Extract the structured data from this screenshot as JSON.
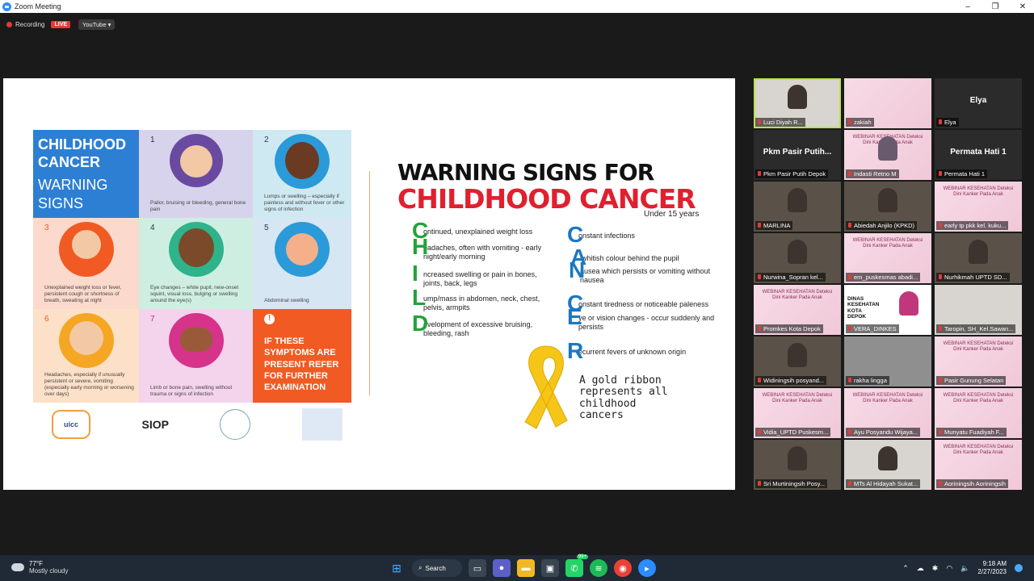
{
  "window": {
    "title": "Zoom Meeting",
    "controls": [
      "–",
      "❐",
      "✕"
    ]
  },
  "meeting": {
    "recording_label": "Recording",
    "live_badge": "LIVE",
    "stream_menu": "YouTube ▾"
  },
  "slide": {
    "poster": {
      "title_bold": "CHILDHOOD CANCER",
      "title_light": "WARNING SIGNS",
      "cells": [
        {
          "num": "1",
          "text": "Pallor, bruising or bleeding, general bone pain"
        },
        {
          "num": "2",
          "text": "Lumps or swelling – especially if painless and without fever or other signs of infection"
        },
        {
          "num": "3",
          "text": "Unexplained weight loss or fever, persistent cough or shortness of breath, sweating at night"
        },
        {
          "num": "4",
          "text": "Eye changes – white pupil, new-onset squint, visual loss, bulging or swelling around the eye(s)"
        },
        {
          "num": "5",
          "text": "Abdominal swelling"
        },
        {
          "num": "6",
          "text": "Headaches, especially if unusually persistent or severe, vomiting (especially early morning or worsening over days)"
        },
        {
          "num": "7",
          "text": "Limb or bone pain, swelling without trauma or signs of infection"
        }
      ],
      "cta_text": "IF THESE SYMPTOMS ARE PRESENT REFER FOR FURTHER EXAMINATION",
      "logos": [
        "uicc",
        "SIOP"
      ]
    },
    "ws_title_1": "WARNING SIGNS FOR",
    "ws_title_2": "CHILDHOOD CANCER",
    "ws_subtitle": "Under 15 years",
    "child": [
      {
        "letter": "C",
        "text": "ontinued, unexplained weight loss"
      },
      {
        "letter": "H",
        "text": "eadaches, often with vomiting - early night/early morning"
      },
      {
        "letter": "I",
        "text": "ncreased swelling or pain in bones, joints, back, legs"
      },
      {
        "letter": "L",
        "text": "ump/mass in abdomen, neck, chest, pelvis, armpits"
      },
      {
        "letter": "D",
        "text": "evelopment of excessive bruising, bleeding, rash"
      }
    ],
    "cancer": [
      {
        "letter": "C",
        "text": "onstant infections"
      },
      {
        "letter": "A",
        "text": "whitish colour behind the pupil"
      },
      {
        "letter": "N",
        "text": "ausea which persists or vomiting without nausea"
      },
      {
        "letter": "C",
        "text": "onstant tiredness or noticeable paleness"
      },
      {
        "letter": "E",
        "text": "ye or vision changes - occur suddenly and persists"
      },
      {
        "letter": "R",
        "text": "ecurrent fevers of unknown origin"
      }
    ],
    "ribbon_text": "A gold ribbon represents all childhood cancers"
  },
  "participants": [
    {
      "name": "Luci Diyah R...",
      "kind": "photo-light",
      "active": true
    },
    {
      "name": "zakiah",
      "kind": "slide"
    },
    {
      "name": "Elya",
      "kind": "name",
      "big": "Elya"
    },
    {
      "name": "Pkm Pasir Putih Depok",
      "kind": "name",
      "big": "Pkm Pasir Putih..."
    },
    {
      "name": "Indasti Retno M",
      "kind": "pink-person"
    },
    {
      "name": "Permata Hati 1",
      "kind": "name",
      "big": "Permata Hati 1"
    },
    {
      "name": "MARLINA",
      "kind": "photo"
    },
    {
      "name": "Abiedah Anjilo (KPKD)",
      "kind": "photo"
    },
    {
      "name": "early tp pkk kel. kuku...",
      "kind": "pink"
    },
    {
      "name": "Nurwina_Sopran kel...",
      "kind": "photo"
    },
    {
      "name": "em_puskesmas abadi...",
      "kind": "pink"
    },
    {
      "name": "Nurhikmah UPTD SD...",
      "kind": "photo"
    },
    {
      "name": "Promkes Kota Depok",
      "kind": "pink"
    },
    {
      "name": "VERA_DINKES",
      "kind": "dinkes"
    },
    {
      "name": "Taropin, SH_Kel.Sawan...",
      "kind": "light"
    },
    {
      "name": "Widiningsih posyand...",
      "kind": "photo"
    },
    {
      "name": "rakha lingga",
      "kind": "grey"
    },
    {
      "name": "Pasir Gunung Selatan",
      "kind": "pink"
    },
    {
      "name": "Vidia_UPTD Puskesm...",
      "kind": "pink"
    },
    {
      "name": "Ayu Posyandu Wijaya...",
      "kind": "pink"
    },
    {
      "name": "Munyatu Fuadiyah F...",
      "kind": "pink"
    },
    {
      "name": "Sri Murtiningsih Posy...",
      "kind": "photo"
    },
    {
      "name": "MTs Al Hidayah Sukat...",
      "kind": "light-person"
    },
    {
      "name": "Aoriningsih Aoriningsih",
      "kind": "pink"
    }
  ],
  "slide_banner": "WEBINAR KESEHATAN Deteksi Dini Kanker Pada Anak",
  "dinkes_text": "DINAS KESEHATAN KOTA DEPOK",
  "taskbar": {
    "temp": "77°F",
    "weather": "Mostly cloudy",
    "search": "Search",
    "badge": "99+",
    "time": "9:18 AM",
    "date": "2/27/2023"
  },
  "colors": {
    "accent": "#2d8cff",
    "live": "#e23b3b",
    "active_speaker": "#b8e34a",
    "cancer_red": "#e0202e",
    "child_green": "#22a23a"
  }
}
